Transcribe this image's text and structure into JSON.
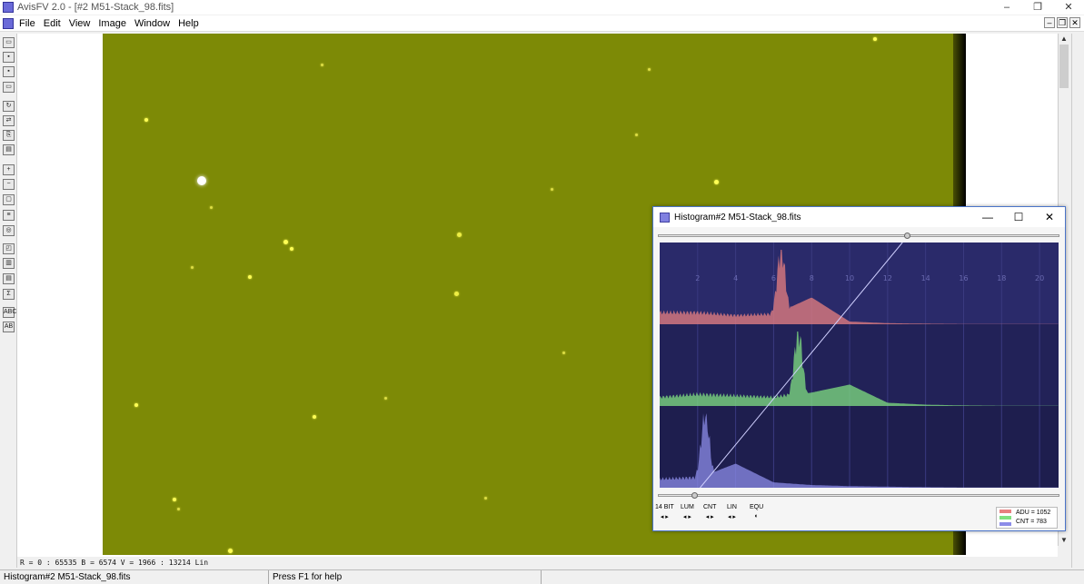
{
  "app": {
    "title": "AvisFV 2.0 - [#2 M51-Stack_98.fits]",
    "window_controls": {
      "minimize": "–",
      "restore": "❐",
      "close": "✕"
    }
  },
  "menu": {
    "items": [
      "File",
      "Edit",
      "View",
      "Image",
      "Window",
      "Help"
    ],
    "mdi_controls": [
      "–",
      "❐",
      "✕"
    ]
  },
  "toolbar": {
    "icons": [
      {
        "name": "open-folder-icon",
        "glyph": "▭"
      },
      {
        "name": "save-icon",
        "glyph": "▪"
      },
      {
        "name": "save-all-icon",
        "glyph": "▪"
      },
      {
        "name": "folder-icon",
        "glyph": "▭"
      },
      {
        "name": "refresh-icon",
        "glyph": "↻"
      },
      {
        "name": "transform-icon",
        "glyph": "⇄"
      },
      {
        "name": "copy-icon",
        "glyph": "⎘"
      },
      {
        "name": "paste-icon",
        "glyph": "▤"
      },
      {
        "name": "zoom-in-icon",
        "glyph": "+"
      },
      {
        "name": "zoom-out-icon",
        "glyph": "−"
      },
      {
        "name": "monitor-icon",
        "glyph": "▢"
      },
      {
        "name": "adjust-icon",
        "glyph": "≡"
      },
      {
        "name": "target-icon",
        "glyph": "◎"
      },
      {
        "name": "zoom-box-icon",
        "glyph": "◰"
      },
      {
        "name": "histogram-icon",
        "glyph": "▥"
      },
      {
        "name": "document-icon",
        "glyph": "▤"
      },
      {
        "name": "sum-icon",
        "glyph": "Σ"
      },
      {
        "name": "abc-icon",
        "glyph": "ABC"
      },
      {
        "name": "abc-edit-icon",
        "glyph": "AB"
      }
    ]
  },
  "image": {
    "background": "#7d8a06",
    "readout": "R = 0 : 65535    B = 6574    V = 1966 : 13214 Lin"
  },
  "status": {
    "pane_left": "Histogram#2 M51-Stack_98.fits",
    "pane_help": "Press F1 for help"
  },
  "histogram": {
    "title": "Histogram#2 M51-Stack_98.fits",
    "controls": {
      "minimize": "—",
      "maximize": "☐",
      "close": "✕"
    },
    "top_slider_value": 0.62,
    "bottom_slider_value": 0.09,
    "buttons": [
      {
        "label": "14 BIT",
        "arrows": "◂ ▸"
      },
      {
        "label": "LUM",
        "arrows": "◂ ▸"
      },
      {
        "label": "CNT",
        "arrows": "◂ ▸"
      },
      {
        "label": "LIN",
        "arrows": "◂ ▸"
      },
      {
        "label": "EQU",
        "arrows": "◐"
      }
    ],
    "legend": {
      "adu": "ADU = 1052",
      "cnt": "CNT = 783"
    },
    "colors": {
      "red": "#e88080",
      "green": "#80e080",
      "blue": "#8c8ce8",
      "bg": "#1e1e56"
    }
  },
  "chart_data": {
    "type": "area",
    "xlim": [
      0,
      21
    ],
    "x_ticks": [
      "2",
      "4",
      "6",
      "8",
      "10",
      "12",
      "14",
      "16",
      "18",
      "20"
    ],
    "grid": true,
    "series": [
      {
        "peak_x": 6.4,
        "values_at_ticks": [
          0.4,
          0.4,
          0.3,
          0.35,
          1.0,
          0.1,
          0.04,
          0.02,
          0.01,
          0.01,
          0.01
        ]
      },
      {
        "peak_x": 7.3,
        "values_at_ticks": [
          0.3,
          0.4,
          0.35,
          0.3,
          0.5,
          0.8,
          0.12,
          0.05,
          0.02,
          0.01,
          0.01
        ]
      },
      {
        "peak_x": 2.4,
        "values_at_ticks": [
          0.3,
          0.35,
          0.9,
          0.2,
          0.1,
          0.06,
          0.04,
          0.02,
          0.01,
          0.01,
          0.01
        ]
      }
    ]
  }
}
